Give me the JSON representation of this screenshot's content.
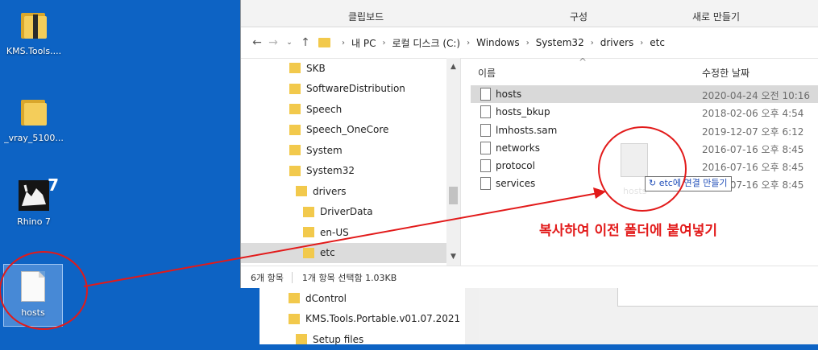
{
  "desktop": {
    "icons": [
      {
        "label": "KMS.Tools....",
        "icon": "zip-folder-icon"
      },
      {
        "label": "_vray_5100...",
        "icon": "folder-icon"
      },
      {
        "label": "Rhino 7",
        "icon": "rhino-app-icon"
      },
      {
        "label": "hosts",
        "icon": "file-icon"
      }
    ],
    "rhino_badge": "7"
  },
  "ribbon": {
    "groups": [
      "클립보드",
      "구성",
      "새로 만들기"
    ]
  },
  "address": {
    "path": [
      "내 PC",
      "로컬 디스크 (C:)",
      "Windows",
      "System32",
      "drivers",
      "etc"
    ]
  },
  "navpane": {
    "items": [
      {
        "label": "SKB",
        "indent": 0
      },
      {
        "label": "SoftwareDistribution",
        "indent": 0
      },
      {
        "label": "Speech",
        "indent": 0
      },
      {
        "label": "Speech_OneCore",
        "indent": 0
      },
      {
        "label": "System",
        "indent": 0
      },
      {
        "label": "System32",
        "indent": 0
      },
      {
        "label": "drivers",
        "indent": 1
      },
      {
        "label": "DriverData",
        "indent": 2
      },
      {
        "label": "en-US",
        "indent": 2
      },
      {
        "label": "etc",
        "indent": 2,
        "selected": true
      }
    ]
  },
  "filelist": {
    "col_name": "이름",
    "col_date": "수정한 날짜",
    "files": [
      {
        "name": "hosts",
        "date": "2020-04-24 오전 10:16",
        "selected": true
      },
      {
        "name": "hosts_bkup",
        "date": "2018-02-06 오후 4:54"
      },
      {
        "name": "lmhosts.sam",
        "date": "2019-12-07 오후 6:12"
      },
      {
        "name": "networks",
        "date": "2016-07-16 오후 8:45"
      },
      {
        "name": "protocol",
        "date": "2016-07-16 오후 8:45"
      },
      {
        "name": "services",
        "date": "2016-07-16 오후 8:45"
      }
    ]
  },
  "status": {
    "count": "6개 항목",
    "selection": "1개 항목 선택함 1.03KB"
  },
  "drag": {
    "ghost_label": "hosts",
    "tooltip": "↻ etc에 연결 만들기"
  },
  "back_window": {
    "items": [
      "dControl",
      "KMS.Tools.Portable.v01.07.2021",
      "Setup files"
    ]
  },
  "annotation": {
    "text": "복사하여 이전 폴더에 붙여넣기",
    "color": "#e21a1a"
  },
  "colors": {
    "desktop_bg": "#0d63c4",
    "folder": "#f2c94c",
    "selection": "#d9d9d9"
  }
}
